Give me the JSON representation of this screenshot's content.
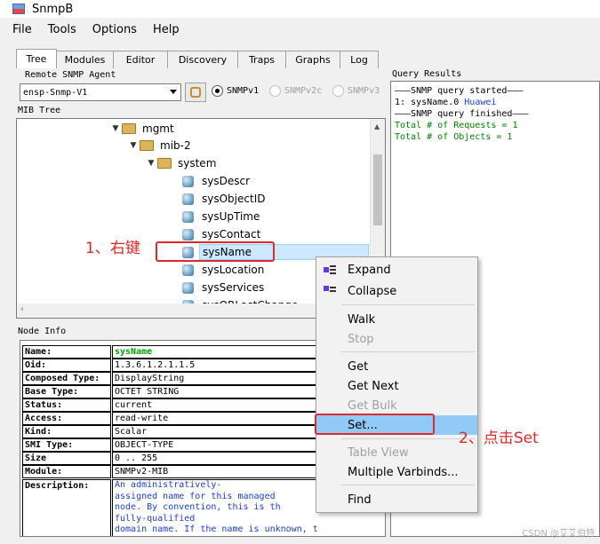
{
  "window": {
    "title": "SnmpB"
  },
  "menu": [
    "File",
    "Tools",
    "Options",
    "Help"
  ],
  "tabs": [
    "Tree",
    "Modules",
    "Editor",
    "Discovery",
    "Traps",
    "Graphs",
    "Log"
  ],
  "agent": {
    "group_label": "Remote SNMP Agent",
    "selected": "ensp-Snmp-V1",
    "versions": [
      "SNMPv1",
      "SNMPv2c",
      "SNMPv3"
    ]
  },
  "mib_tree": {
    "label": "MIB Tree",
    "nodes": [
      "mgmt",
      "mib-2",
      "system",
      "sysDescr",
      "sysObjectID",
      "sysUpTime",
      "sysContact",
      "sysName",
      "sysLocation",
      "sysServices",
      "sysORLastChange"
    ]
  },
  "node_info": {
    "label": "Node Info",
    "rows": [
      {
        "key": "Name:",
        "value": "sysName"
      },
      {
        "key": "Oid:",
        "value": "1.3.6.1.2.1.1.5"
      },
      {
        "key": "Composed Type:",
        "value": "DisplayString"
      },
      {
        "key": "Base Type:",
        "value": "OCTET STRING"
      },
      {
        "key": "Status:",
        "value": "current"
      },
      {
        "key": "Access:",
        "value": "read-write"
      },
      {
        "key": "Kind:",
        "value": "Scalar"
      },
      {
        "key": "SMI Type:",
        "value": "OBJECT-TYPE"
      },
      {
        "key": "Size",
        "value": "0 .. 255"
      },
      {
        "key": "Module:",
        "value": "SNMPv2-MIB"
      }
    ],
    "description_key": "Description:",
    "description_lines": [
      "An  administratively-",
      "assigned name  for  this  managed",
      "node.   By convention,  this  is  th",
      "  fully-qualified",
      "domain  name.   If  the  name  is  unknown,  t"
    ]
  },
  "query": {
    "label": "Query Results",
    "started": "———SNMP query started———",
    "result_prefix": "1: sysName.0",
    "result_value": "Huawei",
    "finished": "———SNMP query finished———",
    "requests": "Total # of Requests = 1",
    "objects": "Total # of Objects = 1"
  },
  "context_menu": {
    "items": [
      "Expand",
      "Collapse",
      "Walk",
      "Stop",
      "Get",
      "Get Next",
      "Get Bulk",
      "Set...",
      "Table View",
      "Multiple Varbinds...",
      "Find"
    ]
  },
  "annotations": {
    "step1": "1、右键",
    "step2": "2、点击Set"
  },
  "watermark": "CSDN @艾艾伯特"
}
